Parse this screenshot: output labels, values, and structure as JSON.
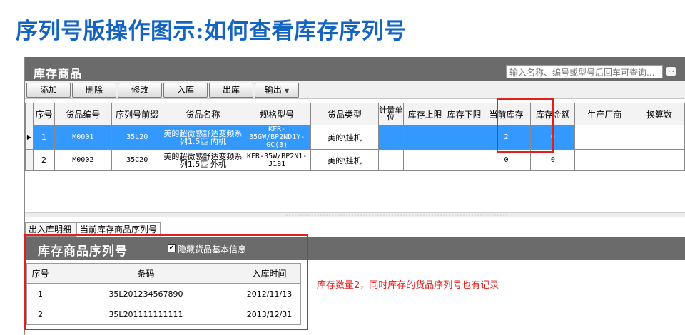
{
  "page_heading": "序列号版操作图示:如何查看库存序列号",
  "inventory_panel": {
    "title": "库存商品",
    "search_placeholder": "输入名称、编号或型号后回车可查询..."
  },
  "toolbar": {
    "add": "添加",
    "delete": "删除",
    "edit": "修改",
    "stock_in": "入库",
    "stock_out": "出库",
    "export": "输出"
  },
  "inventory_table": {
    "headers": [
      "序号",
      "货品编号",
      "序列号前缀",
      "货品名称",
      "规格型号",
      "货品类型",
      "计量单位",
      "库存上限",
      "库存下限",
      "当前库存",
      "库存金额",
      "生产厂商",
      "换算数"
    ],
    "rows": [
      {
        "index": "1",
        "code": "M0001",
        "prefix": "35L20",
        "name": "美的超微感舒适变频系列1.5匹 内机",
        "spec": "KFR-35GW/BP2ND1Y-GC(3)",
        "type": "美的\\挂机",
        "unit": "",
        "upper": "",
        "lower": "",
        "current": "2",
        "amount": "0",
        "maker": "",
        "conversion": ""
      },
      {
        "index": "2",
        "code": "M0002",
        "prefix": "35C20",
        "name": "美的超微感舒适变频系列1.5匹 外机",
        "spec": "KFR-35W/BP2N1-J181",
        "type": "美的\\挂机",
        "unit": "",
        "upper": "",
        "lower": "",
        "current": "0",
        "amount": "0",
        "maker": "",
        "conversion": ""
      }
    ]
  },
  "subtabs": [
    "出入库明细",
    "当前库存商品序列号"
  ],
  "serial_panel": {
    "title": "库存商品序列号",
    "hide_basic_info_label": "隐藏货品基本信息",
    "hide_basic_info_checked": "✔"
  },
  "serial_table": {
    "headers": [
      "序号",
      "条码",
      "入库时间"
    ],
    "rows": [
      {
        "index": "1",
        "barcode": "35L201234567890",
        "date": "2012/11/13"
      },
      {
        "index": "2",
        "barcode": "35L201111111111",
        "date": "2013/12/31"
      }
    ]
  },
  "annotation": "库存数量2，同时库存的货品序列号也有记录",
  "colors": {
    "heading": "#1565c0",
    "panel_header": "#6b6b6b",
    "selected_row": "#3399ff",
    "highlight_box": "#e02020"
  }
}
